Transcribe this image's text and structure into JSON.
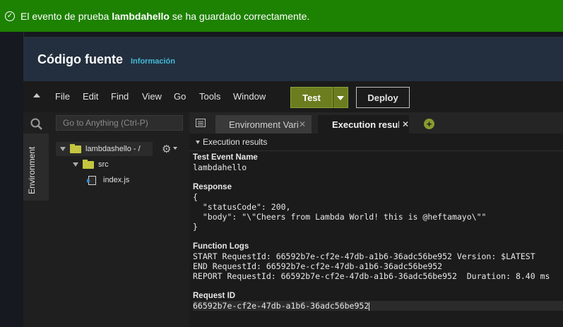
{
  "banner": {
    "prefix": "El evento de prueba ",
    "event_name": "lambdahello",
    "suffix": " se ha guardado correctamente.",
    "color": "#1d8102"
  },
  "header": {
    "title": "Código fuente",
    "info_link": "Información"
  },
  "menu": {
    "items": [
      "File",
      "Edit",
      "Find",
      "View",
      "Go",
      "Tools",
      "Window"
    ],
    "test_label": "Test",
    "deploy_label": "Deploy"
  },
  "sidebar": {
    "tab_label": "Environment",
    "search_placeholder": "Go to Anything (Ctrl-P)",
    "tree": {
      "root": "lambdashello - /",
      "folder": "src",
      "file": "index.js"
    }
  },
  "editor": {
    "tabs": [
      {
        "label": "Environment Vari",
        "active": false
      },
      {
        "label": "Execution results",
        "active": true
      }
    ],
    "results_header": "Execution results",
    "results": {
      "test_event_title": "Test Event Name",
      "test_event_value": "lambdahello",
      "response_title": "Response",
      "response_lines": [
        "{",
        "  \"statusCode\": 200,",
        "  \"body\": \"\\\"Cheers from Lambda World! this is @heftamayo\\\"\"",
        "}"
      ],
      "logs_title": "Function Logs",
      "log_lines": [
        "START RequestId: 66592b7e-cf2e-47db-a1b6-36adc56be952 Version: $LATEST",
        "END RequestId: 66592b7e-cf2e-47db-a1b6-36adc56be952",
        "REPORT RequestId: 66592b7e-cf2e-47db-a1b6-36adc56be952  Duration: 8.40 ms"
      ],
      "request_id_title": "Request ID",
      "request_id_value": "66592b7e-cf2e-47db-a1b6-36adc56be952"
    }
  },
  "icons": {
    "banner": "check-circle-icon",
    "collapse": "caret-up-icon",
    "search": "search-icon",
    "settings": "gear-icon",
    "new_tab": "plus-circle-icon"
  }
}
